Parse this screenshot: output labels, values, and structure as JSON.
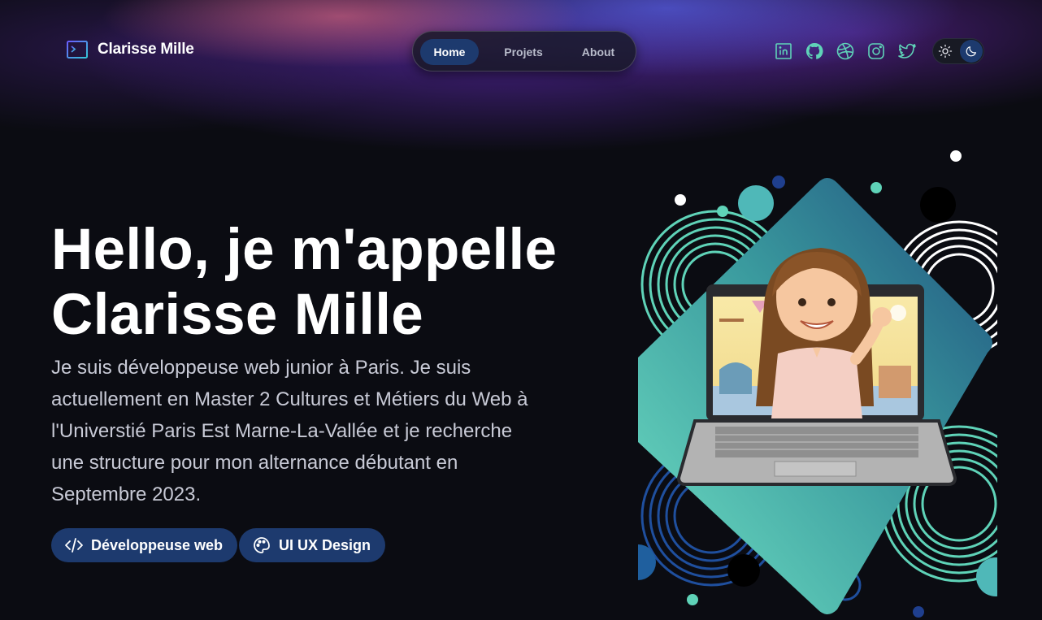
{
  "brand": {
    "name": "Clarisse Mille",
    "icon": "terminal-icon"
  },
  "nav": {
    "items": [
      {
        "label": "Home",
        "active": true
      },
      {
        "label": "Projets",
        "active": false
      },
      {
        "label": "About",
        "active": false
      }
    ]
  },
  "social": [
    {
      "name": "linkedin-icon"
    },
    {
      "name": "github-icon"
    },
    {
      "name": "dribbble-icon"
    },
    {
      "name": "instagram-icon"
    },
    {
      "name": "twitter-icon"
    }
  ],
  "theme_toggle": {
    "icons": [
      "sun-icon",
      "moon-icon"
    ],
    "selected": "dark"
  },
  "hero": {
    "title_line1": "Hello, je m'appelle",
    "title_line2": "Clarisse Mille",
    "intro": "Je suis développeuse web junior à Paris. Je suis actuellement en Master 2 Cultures et Métiers du Web à l'Universtié Paris Est Marne-La-Vallée et je recherche une structure pour mon alternance débutant en Septembre 2023.",
    "chips": [
      {
        "label": "Développeuse web",
        "icon": "code-icon"
      },
      {
        "label": "UI UX Design",
        "icon": "palette-icon"
      }
    ]
  },
  "colors": {
    "background": "#0b0c12",
    "accent": "#1d3a6e",
    "teal": "#5fd3b8",
    "nav_text": "#b9bccb"
  },
  "illustration": {
    "description_icon": "avatar-laptop-illustration"
  }
}
